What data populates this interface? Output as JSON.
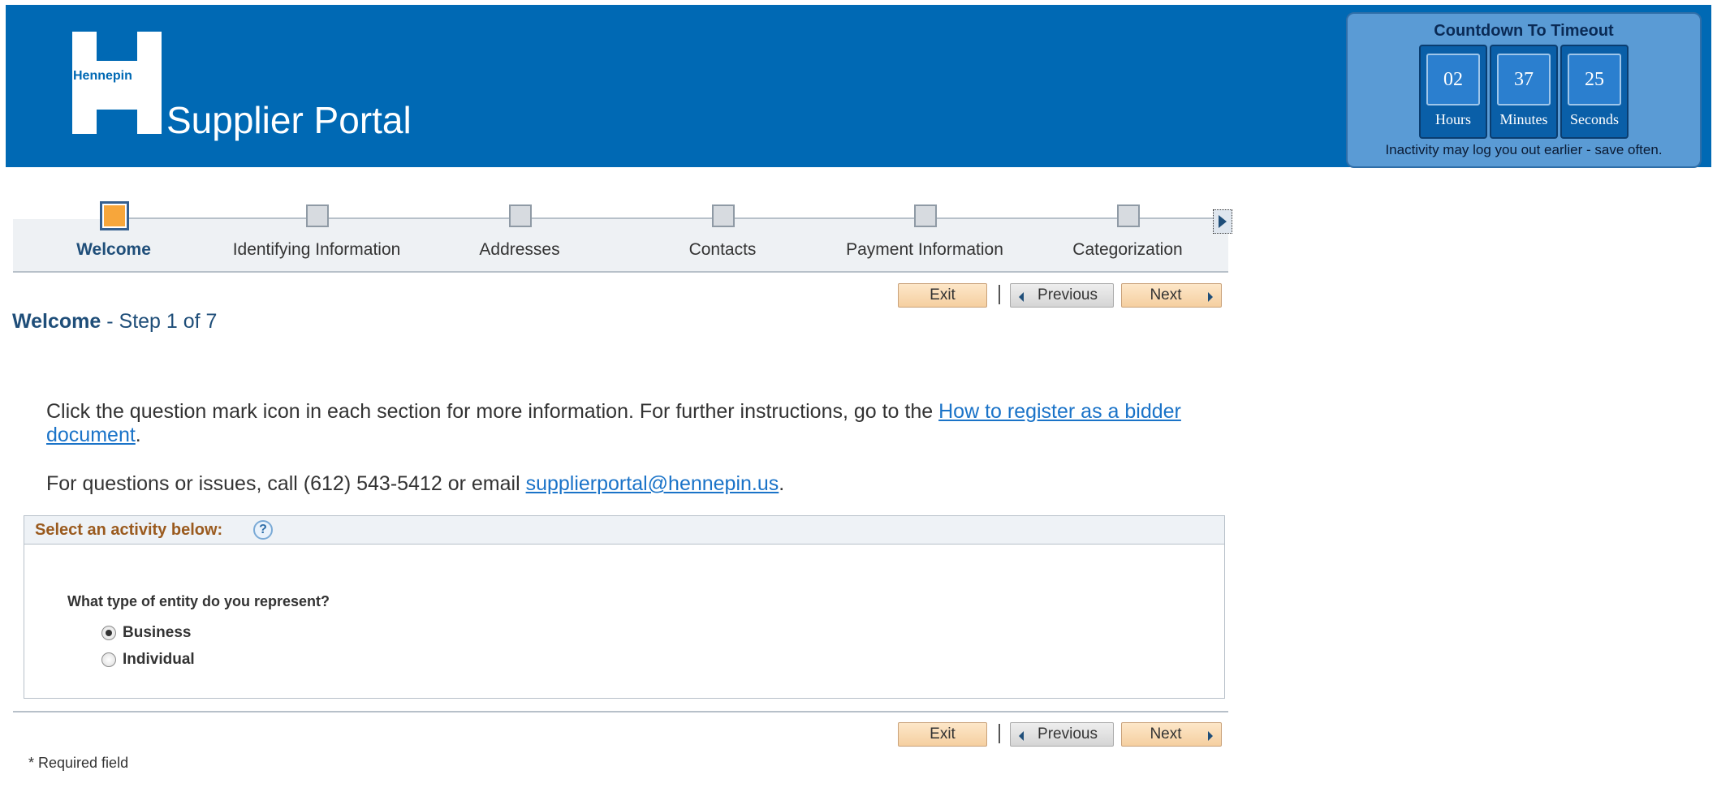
{
  "header": {
    "logo_text": "Hennepin",
    "title": "Supplier Portal",
    "brand_color": "#0069b4"
  },
  "countdown": {
    "title": "Countdown To Timeout",
    "hours": "02",
    "hours_label": "Hours",
    "minutes": "37",
    "minutes_label": "Minutes",
    "seconds": "25",
    "seconds_label": "Seconds",
    "note": "Inactivity may log you out earlier - save often."
  },
  "steps": [
    {
      "label": "Welcome",
      "active": true
    },
    {
      "label": "Identifying Information",
      "active": false
    },
    {
      "label": "Addresses",
      "active": false
    },
    {
      "label": "Contacts",
      "active": false
    },
    {
      "label": "Payment Information",
      "active": false
    },
    {
      "label": "Categorization",
      "active": false
    }
  ],
  "nav": {
    "exit": "Exit",
    "previous": "Previous",
    "next": "Next"
  },
  "page": {
    "heading": "Welcome",
    "step_text": " - Step 1 of 7",
    "instructions_text": "Click the question mark icon in each section for more information. For further instructions, go to the ",
    "instructions_link": "How to register as a bidder document",
    "instructions_end": ".",
    "contact_text": "For questions or issues, call (612) 543-5412 or email ",
    "contact_link": "supplierportal@hennepin.us",
    "contact_end": "."
  },
  "activity": {
    "title": "Select an activity below:",
    "help": "?",
    "question": "What type of entity do you represent?",
    "options": [
      {
        "label": "Business",
        "checked": true
      },
      {
        "label": "Individual",
        "checked": false
      }
    ]
  },
  "footer": {
    "required_note": "* Required field"
  }
}
